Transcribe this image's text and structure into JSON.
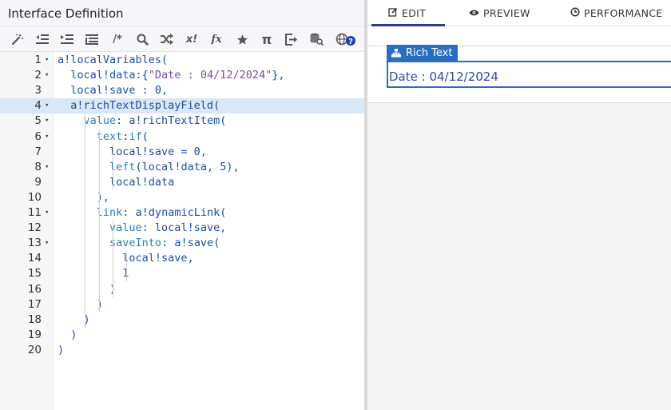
{
  "left_panel": {
    "title": "Interface Definition",
    "toolbar": [
      {
        "name": "magic-wand-icon"
      },
      {
        "name": "outdent-icon"
      },
      {
        "name": "indent-icon"
      },
      {
        "name": "format-icon"
      },
      {
        "name": "comment-icon",
        "label": "/*"
      },
      {
        "name": "search-icon"
      },
      {
        "name": "shuffle-icon"
      },
      {
        "name": "expression-icon",
        "label": "x!"
      },
      {
        "name": "function-icon",
        "label": "fx"
      },
      {
        "name": "star-icon"
      },
      {
        "name": "pi-icon",
        "label": "π"
      },
      {
        "name": "export-icon"
      },
      {
        "name": "database-search-icon"
      },
      {
        "name": "globe-help-icon"
      }
    ]
  },
  "code": {
    "lines": [
      {
        "n": "1",
        "fold": true,
        "text": "a!localVariables("
      },
      {
        "n": "2",
        "fold": true,
        "text": "  local!data:{\"Date : 04/12/2024\"},"
      },
      {
        "n": "3",
        "fold": false,
        "text": "  local!save : 0,"
      },
      {
        "n": "4",
        "fold": true,
        "text": "  a!richTextDisplayField(",
        "highlight": true
      },
      {
        "n": "5",
        "fold": true,
        "text": "    value: a!richTextItem("
      },
      {
        "n": "6",
        "fold": true,
        "text": "      text:if("
      },
      {
        "n": "7",
        "fold": false,
        "text": "        local!save = 0,"
      },
      {
        "n": "8",
        "fold": true,
        "text": "        left(local!data, 5),"
      },
      {
        "n": "9",
        "fold": false,
        "text": "        local!data"
      },
      {
        "n": "10",
        "fold": false,
        "text": "      ),"
      },
      {
        "n": "11",
        "fold": true,
        "text": "      link: a!dynamicLink("
      },
      {
        "n": "12",
        "fold": false,
        "text": "        value: local!save,"
      },
      {
        "n": "13",
        "fold": true,
        "text": "        saveInto: a!save("
      },
      {
        "n": "14",
        "fold": false,
        "text": "          local!save,"
      },
      {
        "n": "15",
        "fold": false,
        "text": "          1"
      },
      {
        "n": "16",
        "fold": false,
        "text": "        )"
      },
      {
        "n": "17",
        "fold": false,
        "text": "      )"
      },
      {
        "n": "18",
        "fold": false,
        "text": "    )"
      },
      {
        "n": "19",
        "fold": false,
        "text": "  )"
      },
      {
        "n": "20",
        "fold": false,
        "text": ")"
      }
    ]
  },
  "right_panel": {
    "tabs": [
      {
        "label": "EDIT",
        "icon": "edit-icon",
        "active": true
      },
      {
        "label": "PREVIEW",
        "icon": "eye-icon",
        "active": false
      },
      {
        "label": "PERFORMANCE",
        "icon": "clock-icon",
        "active": false
      }
    ],
    "component": {
      "label": "Rich Text",
      "value": "Date : 04/12/2024"
    }
  },
  "colors": {
    "accent": "#2a6fbf",
    "tab_underline": "#2d3b8a",
    "line_highlight": "#d9e7f7"
  }
}
